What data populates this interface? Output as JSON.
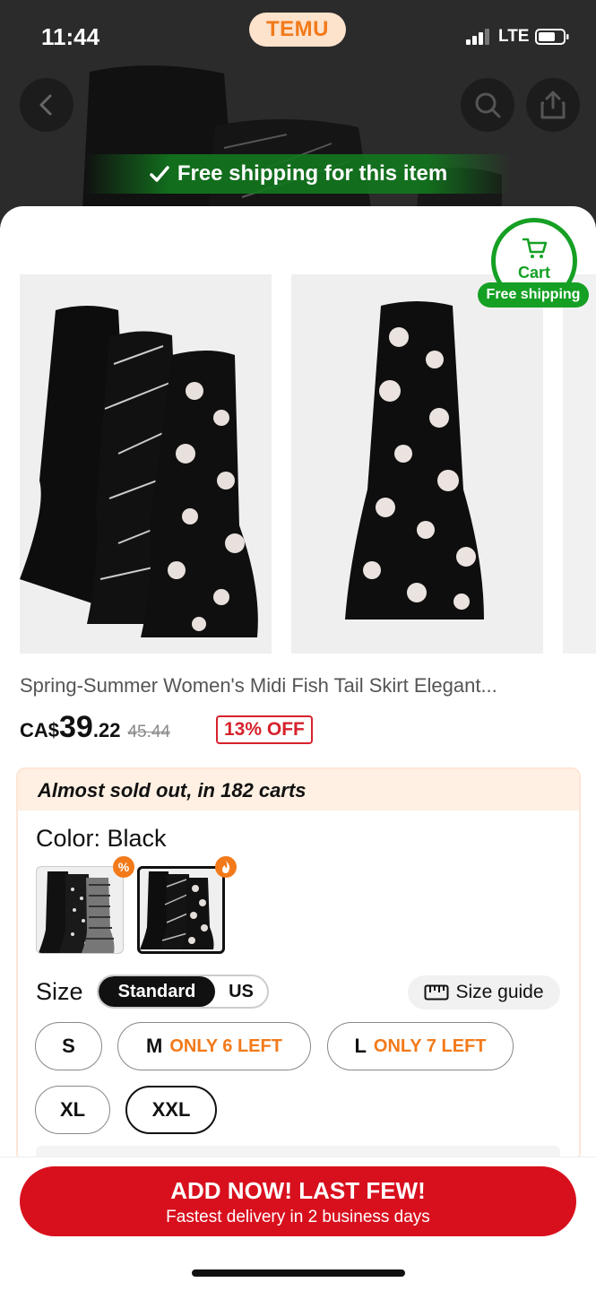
{
  "status_bar": {
    "time": "11:44",
    "network": "LTE"
  },
  "brand": {
    "logo_text": "TEMU"
  },
  "hero": {
    "free_shipping_banner": "Free shipping for this item"
  },
  "cart_badge": {
    "label": "Cart",
    "shipping": "Free shipping"
  },
  "product": {
    "title": "Spring-Summer Women's Midi Fish Tail Skirt Elegant...",
    "price": {
      "currency": "CA$",
      "integer": "39",
      "decimal": ".22",
      "original": "45.44",
      "discount": "13% OFF"
    }
  },
  "options": {
    "alert": "Almost sold out, in 182 carts",
    "color_label": "Color: Black",
    "color_badges": [
      "%",
      "🔥"
    ],
    "size_label": "Size",
    "size_systems": [
      "Standard",
      "US"
    ],
    "size_guide": "Size guide",
    "sizes": [
      {
        "label": "S",
        "note": ""
      },
      {
        "label": "M",
        "note": "ONLY 6 LEFT"
      },
      {
        "label": "L",
        "note": "ONLY 7 LEFT"
      },
      {
        "label": "XL",
        "note": ""
      },
      {
        "label": "XXL",
        "note": ""
      }
    ],
    "selected_size": "XXL"
  },
  "cta": {
    "main": "ADD NOW! LAST FEW!",
    "sub": "Fastest delivery in 2 business days"
  },
  "colors": {
    "accent_orange": "#f27a1a",
    "cta_red": "#d8101e",
    "shipping_green": "#15a024"
  }
}
